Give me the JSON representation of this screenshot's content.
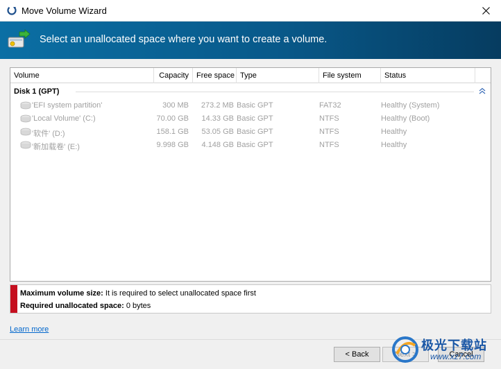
{
  "window": {
    "title": "Move Volume Wizard"
  },
  "banner": {
    "text": "Select an unallocated space where you want to create a volume."
  },
  "table": {
    "columns": [
      "Volume",
      "Capacity",
      "Free space",
      "Type",
      "File system",
      "Status"
    ],
    "group": {
      "label": "Disk 1 (GPT)"
    },
    "rows": [
      {
        "name": "'EFI system partition'",
        "capacity": "300 MB",
        "free": "273.2 MB",
        "type": "Basic GPT",
        "fs": "FAT32",
        "status": "Healthy (System)"
      },
      {
        "name": "'Local Volume' (C:)",
        "capacity": "70.00 GB",
        "free": "14.33 GB",
        "type": "Basic GPT",
        "fs": "NTFS",
        "status": "Healthy (Boot)"
      },
      {
        "name": "'软件' (D:)",
        "capacity": "158.1 GB",
        "free": "53.05 GB",
        "type": "Basic GPT",
        "fs": "NTFS",
        "status": "Healthy"
      },
      {
        "name": "'新加载卷' (E:)",
        "capacity": "9.998 GB",
        "free": "4.148 GB",
        "type": "Basic GPT",
        "fs": "NTFS",
        "status": "Healthy"
      }
    ]
  },
  "info": {
    "max_label": "Maximum volume size:",
    "max_value": " It is required to select unallocated space first",
    "req_label": "Required unallocated space:",
    "req_value": " 0 bytes"
  },
  "links": {
    "learn_more": "Learn more"
  },
  "buttons": {
    "back": "< Back",
    "next": "Next >",
    "cancel": "Cancel"
  },
  "watermark": {
    "text": "极光下载站",
    "url": "www.xz7.com"
  },
  "colors": {
    "banner": "#0b6fa4",
    "info_bar": "#c50f1f",
    "link": "#0066cc"
  }
}
